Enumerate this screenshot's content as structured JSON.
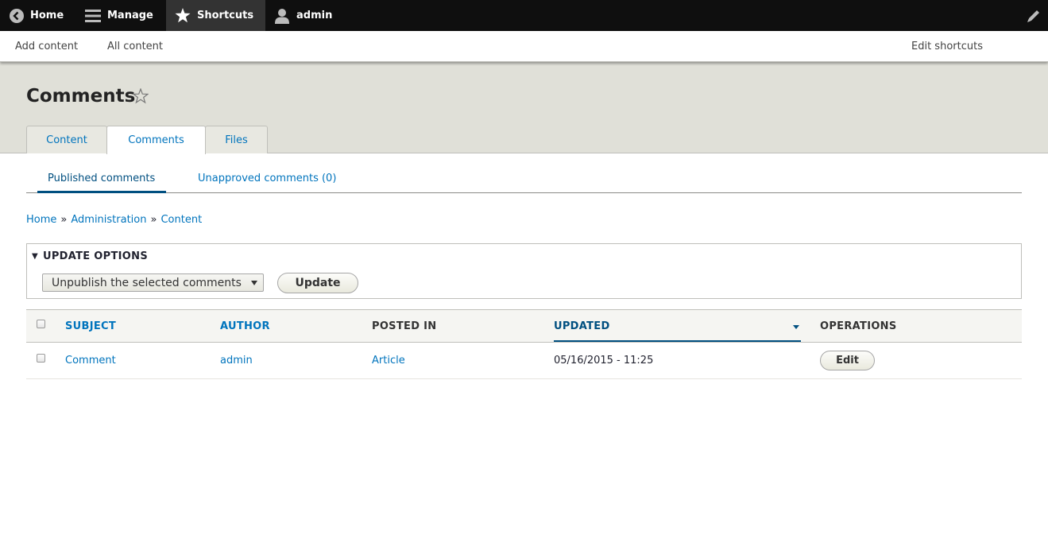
{
  "toolbar": {
    "home": "Home",
    "manage": "Manage",
    "shortcuts": "Shortcuts",
    "user": "admin"
  },
  "tray": {
    "add_content": "Add content",
    "all_content": "All content",
    "edit_shortcuts": "Edit shortcuts"
  },
  "page": {
    "title": "Comments"
  },
  "tabs": [
    {
      "label": "Content",
      "active": false
    },
    {
      "label": "Comments",
      "active": true
    },
    {
      "label": "Files",
      "active": false
    }
  ],
  "subtabs": [
    {
      "label": "Published comments",
      "active": true
    },
    {
      "label": "Unapproved comments (0)",
      "active": false
    }
  ],
  "breadcrumb": [
    "Home",
    "Administration",
    "Content"
  ],
  "breadcrumb_separator": "»",
  "update_options": {
    "legend": "UPDATE OPTIONS",
    "action_selected": "Unpublish the selected comments",
    "update_label": "Update"
  },
  "table": {
    "headers": {
      "subject": "SUBJECT",
      "author": "AUTHOR",
      "posted_in": "POSTED IN",
      "updated": "UPDATED",
      "operations": "OPERATIONS"
    },
    "rows": [
      {
        "subject": "Comment",
        "author": "admin",
        "posted_in": "Article",
        "updated": "05/16/2015 - 11:25",
        "operation": "Edit"
      }
    ]
  },
  "colors": {
    "link": "#0074bd",
    "toolbar_bg": "#0f0f0f",
    "header_bg": "#e0e0d8"
  }
}
